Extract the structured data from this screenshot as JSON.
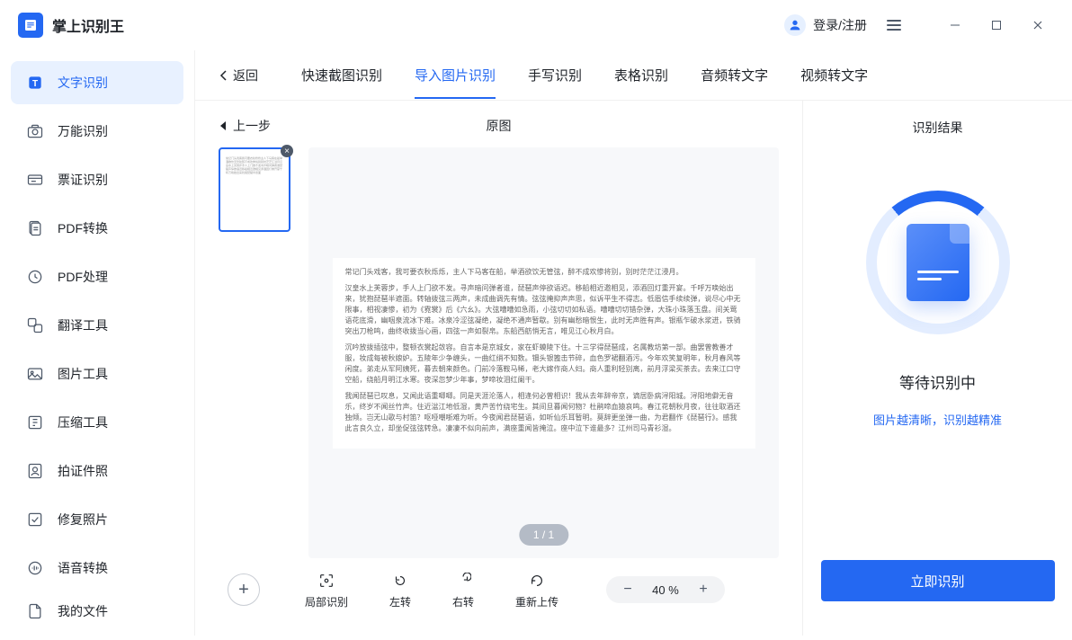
{
  "app": {
    "title": "掌上识别王"
  },
  "titlebar": {
    "login": "登录/注册"
  },
  "sidebar": {
    "items": [
      {
        "label": "文字识别",
        "icon": "text"
      },
      {
        "label": "万能识别",
        "icon": "camera"
      },
      {
        "label": "票证识别",
        "icon": "card"
      },
      {
        "label": "PDF转换",
        "icon": "pdf-convert"
      },
      {
        "label": "PDF处理",
        "icon": "pdf-edit"
      },
      {
        "label": "翻译工具",
        "icon": "translate"
      },
      {
        "label": "图片工具",
        "icon": "image"
      },
      {
        "label": "压缩工具",
        "icon": "compress"
      },
      {
        "label": "拍证件照",
        "icon": "id-photo"
      },
      {
        "label": "修复照片",
        "icon": "repair"
      },
      {
        "label": "语音转换",
        "icon": "voice"
      }
    ],
    "bottom": {
      "label": "我的文件"
    }
  },
  "tabs": {
    "back": "返回",
    "items": [
      {
        "label": "快速截图识别"
      },
      {
        "label": "导入图片识别"
      },
      {
        "label": "手写识别"
      },
      {
        "label": "表格识别"
      },
      {
        "label": "音频转文字"
      },
      {
        "label": "视频转文字"
      }
    ]
  },
  "preview": {
    "prev": "上一步",
    "title": "原图",
    "page_indicator": "1 / 1",
    "doc_text": [
      "常记门头戏客，我可要衣秋烁烁，主人下马客在船，举酒欲饮无管弦，醉不成欢惨将别，别时茫茫江浸月。",
      "汉皇水上芙蓉步，手人上门欲不发。寻声暗问弹者谁，琵琶声停欲语迟。移船相近邀相见，添酒回灯重开宴。千呼万唤始出来，犹抱琵琶半遮面。转轴拨弦三两声，未成曲调先有情。弦弦掩抑声声思，似诉平生不得志。低眉信手续续弹，说尽心中无限事，相视凄惨，初为《霓裳》后《六幺》。大弦嘈嘈如急雨，小弦切切如私语。嘈嘈切切错杂弹，大珠小珠落玉盘。间关莺语花底滑，幽咽泉流冰下难。冰泉冷涩弦凝绝，凝绝不通声暂歇。别有幽愁暗恨生，此时无声胜有声。银瓶乍破水浆迸，铁骑突出刀枪鸣，曲终收拨当心画，四弦一声如裂帛。东船西舫悄无言，唯见江心秋月白。",
      "沉吟放拨插弦中，整顿衣裳起敛容。自言本是京城女，家在虾蟆陵下住。十三学得琵琶成，名属教坊第一部。曲罢曾教善才服，妆成每被秋娘妒。五陵年少争缠头，一曲红绡不知数。钿头银篦击节碎，血色罗裙翻酒污。今年欢笑复明年，秋月春风等闲度。弟走从军阿姨死，暮去朝来颜色。门前冷落鞍马稀，老大嫁作商人妇。商人重利轻别离，前月浮梁买茶去。去来江口守空船，绕船月明江水寒。夜深忽梦少年事，梦啼妆泪红阑干。",
      "我闻琵琶已叹息，又闻此语重唧唧。同是天涯沦落人，相逢何必曾相识！我从去年辞帝京，谪居卧病浔阳城。浔阳地僻无音乐，终岁不闻丝竹声。住近湓江地低湿，黄芦苦竹绕宅生。其间旦暮闻何物？杜鹃啼血猿哀鸣。春江花朝秋月夜，往往取酒还独倾。岂无山歌与村笛？呕哑嘲哳难为听。今夜闻君琵琶语，如听仙乐耳暂明。莫辞更坐弹一曲，为君翻作《琵琶行》。感我此言良久立，却坐促弦弦转急。凄凄不似向前声，满座重闻皆掩泣。座中泣下谁最多？江州司马青衫湿。"
    ]
  },
  "tools": {
    "crop": "局部识别",
    "rotate_left": "左转",
    "rotate_right": "右转",
    "reupload": "重新上传",
    "zoom": "40 %"
  },
  "result": {
    "title": "识别结果",
    "wait": "等待识别中",
    "hint": "图片越清晰，识别越精准",
    "button": "立即识别"
  }
}
